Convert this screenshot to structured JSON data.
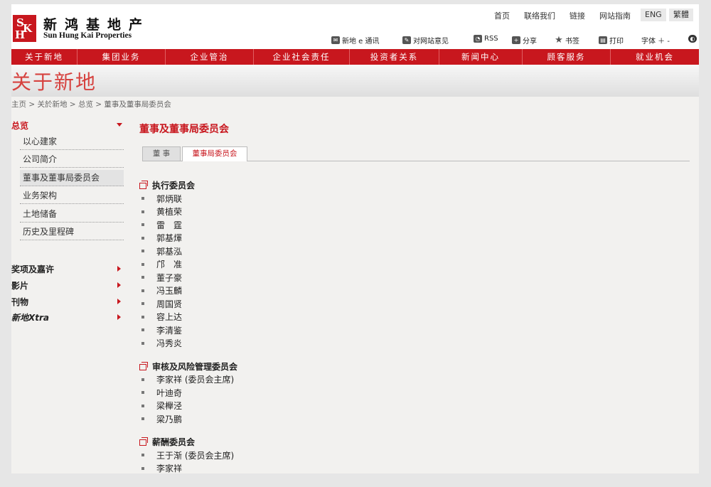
{
  "brand": {
    "name_cn": "新鸿基地产",
    "name_en": "Sun Hung Kai Properties"
  },
  "top_links": [
    "首页",
    "联络我们",
    "链接",
    "网站指南"
  ],
  "languages": [
    "ENG",
    "繁體"
  ],
  "tools": [
    "新地 e 通讯",
    "对网站意见",
    "RSS",
    "分享",
    "书签",
    "打印",
    "字体 ＋ -"
  ],
  "nav": [
    "关于新地",
    "集团业务",
    "企业管治",
    "企业社会责任",
    "投资者关系",
    "新闻中心",
    "顾客服务",
    "就业机会"
  ],
  "banner_title": "关于新地",
  "breadcrumb": "主页 > 关於新地 > 总览 > 董事及董事局委员会",
  "sidebar": {
    "heading": "总览",
    "subitems": [
      "以心建家",
      "公司简介",
      "董事及董事局委员会",
      "业务架构",
      "土地储备",
      "历史及里程碑"
    ],
    "categories": [
      "奖项及嘉许",
      "影片",
      "刊物",
      "新地Xtra"
    ]
  },
  "main": {
    "title": "董事及董事局委员会",
    "tabs": [
      "董 事",
      "董事局委员会"
    ],
    "groups": [
      {
        "title": "执行委员会",
        "members": [
          "郭炳联",
          "黄植荣",
          "雷　霆",
          "郭基煇",
          "郭基泓",
          "邝　准",
          "董子豪",
          "冯玉麟",
          "周国贤",
          "容上达",
          "李清鉴",
          "冯秀炎"
        ]
      },
      {
        "title": "审核及风险管理委员会",
        "members": [
          "李家祥 (委员会主席)",
          "叶迪奇",
          "梁櫸泾",
          "梁乃鹏"
        ]
      },
      {
        "title": "薪酬委员会",
        "members": [
          "王于渐 (委员会主席)",
          "李家祥"
        ]
      }
    ]
  },
  "colors": {
    "brand_red": "#c8171e",
    "banner_text": "#d6423f"
  }
}
